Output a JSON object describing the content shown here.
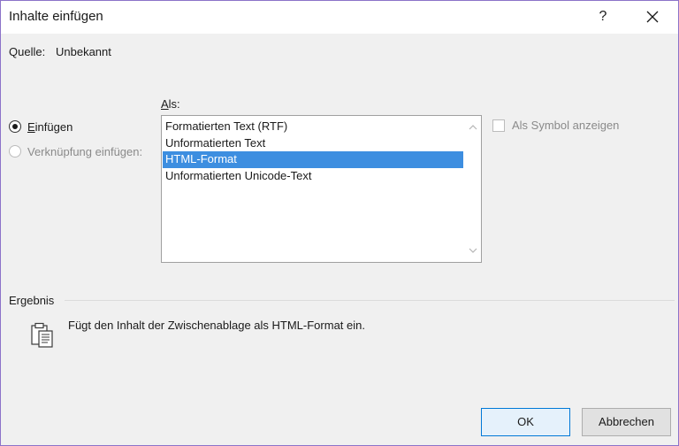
{
  "dialog": {
    "title": "Inhalte einfügen",
    "help_label": "?",
    "source_label": "Quelle:",
    "source_value": "Unbekannt"
  },
  "paste_options": {
    "as_label_first": "A",
    "as_label_rest": "ls:",
    "paste_first": "E",
    "paste_rest": "infügen",
    "paste_checked": true,
    "link_label": "Verknüpfung einfügen:",
    "link_enabled": false
  },
  "formats": {
    "items": [
      "Formatierten Text (RTF)",
      "Unformatierten Text",
      "HTML-Format",
      "Unformatierten Unicode-Text"
    ],
    "selected": "HTML-Format"
  },
  "symbol_checkbox": {
    "label": "Als Symbol anzeigen",
    "checked": false,
    "enabled": false
  },
  "result": {
    "label": "Ergebnis",
    "text": "Fügt den Inhalt der Zwischenablage als HTML-Format ein."
  },
  "buttons": {
    "ok": "OK",
    "cancel": "Abbrechen"
  },
  "colors": {
    "selection": "#3d8ee0",
    "default_button_border": "#0078d7",
    "window_border": "#8c73c9"
  },
  "icons": {
    "close": "close-icon",
    "clipboard": "clipboard-icon",
    "scroll_up": "chevron-up-icon",
    "scroll_down": "chevron-down-icon"
  }
}
